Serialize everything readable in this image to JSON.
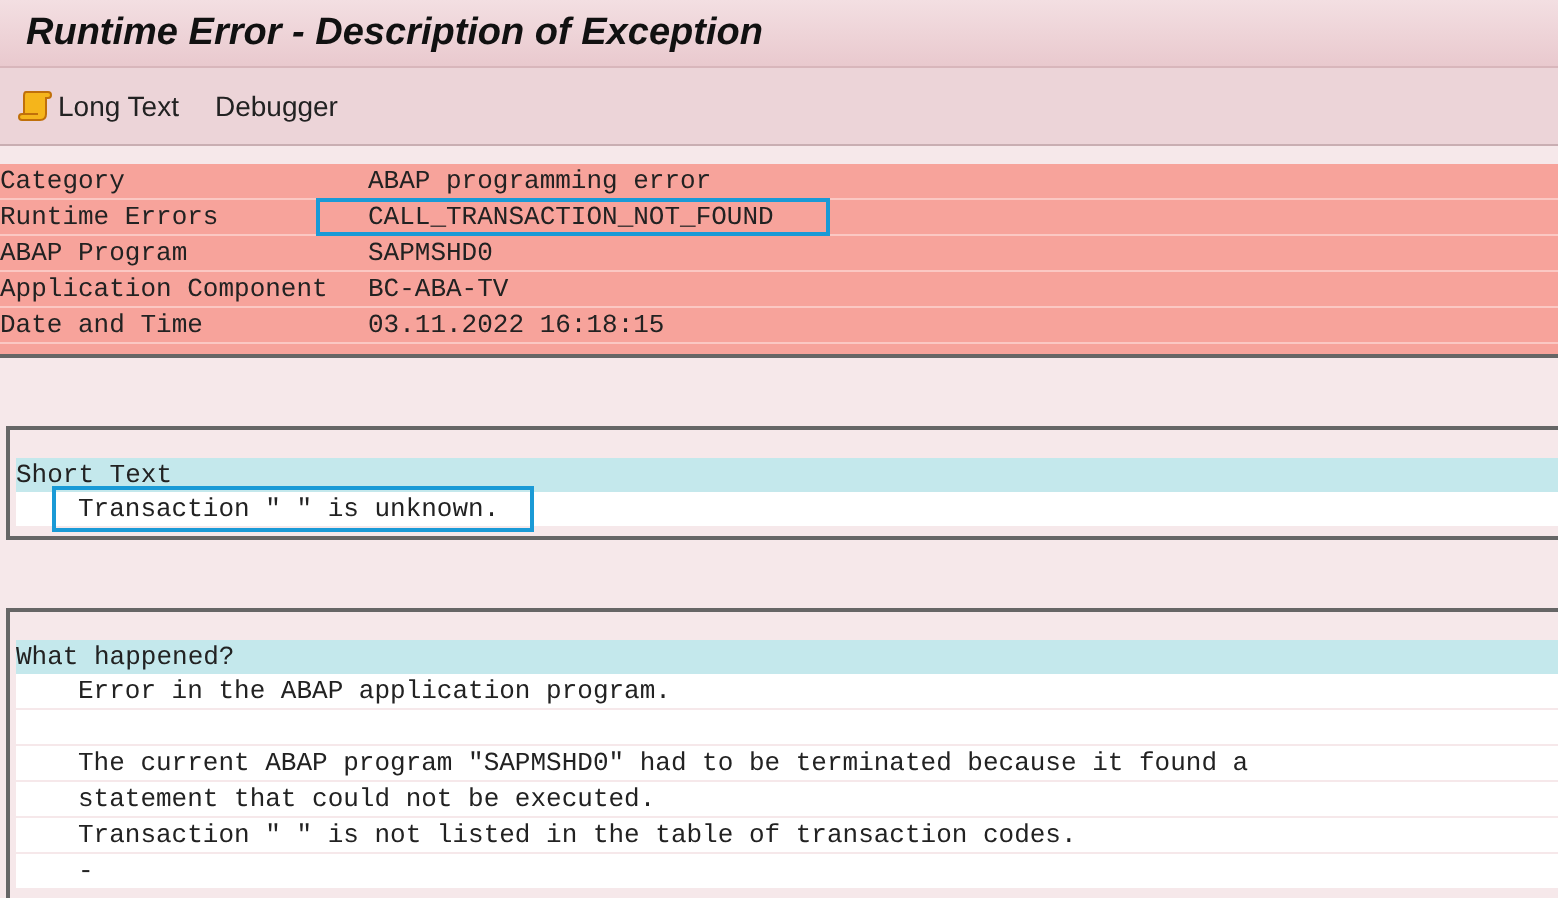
{
  "window": {
    "title": "Runtime Error - Description of Exception"
  },
  "toolbar": [
    {
      "label": "Long Text",
      "kind": "icon"
    },
    {
      "label": "Debugger",
      "kind": "plain"
    }
  ],
  "details": [
    {
      "label": "Category",
      "value": "ABAP programming error",
      "highlighted": false
    },
    {
      "label": "Runtime Errors",
      "value": "CALL_TRANSACTION_NOT_FOUND",
      "highlighted": true
    },
    {
      "label": "ABAP Program",
      "value": "SAPMSHD0",
      "highlighted": false
    },
    {
      "label": "Application Component",
      "value": "BC-ABA-TV",
      "highlighted": false
    },
    {
      "label": "Date and Time",
      "value": "03.11.2022 16:18:15",
      "highlighted": false
    }
  ],
  "sections": [
    {
      "heading": "Short Text",
      "lines": [
        {
          "kind": "text",
          "text": "Transaction \" \" is unknown.",
          "highlighted": true
        }
      ]
    },
    {
      "heading": "What happened?",
      "lines": [
        {
          "kind": "text",
          "text": "Error in the ABAP application program.",
          "highlighted": false
        },
        {
          "kind": "blank"
        },
        {
          "kind": "text",
          "text": "The current ABAP program \"SAPMSHD0\" had to be terminated because it found a",
          "highlighted": false
        },
        {
          "kind": "text",
          "text": "statement that could not be executed.",
          "highlighted": false
        },
        {
          "kind": "text",
          "text": "Transaction \" \" is not listed in the table of transaction codes.",
          "highlighted": false
        },
        {
          "kind": "text",
          "text": "-",
          "highlighted": false
        }
      ]
    }
  ]
}
